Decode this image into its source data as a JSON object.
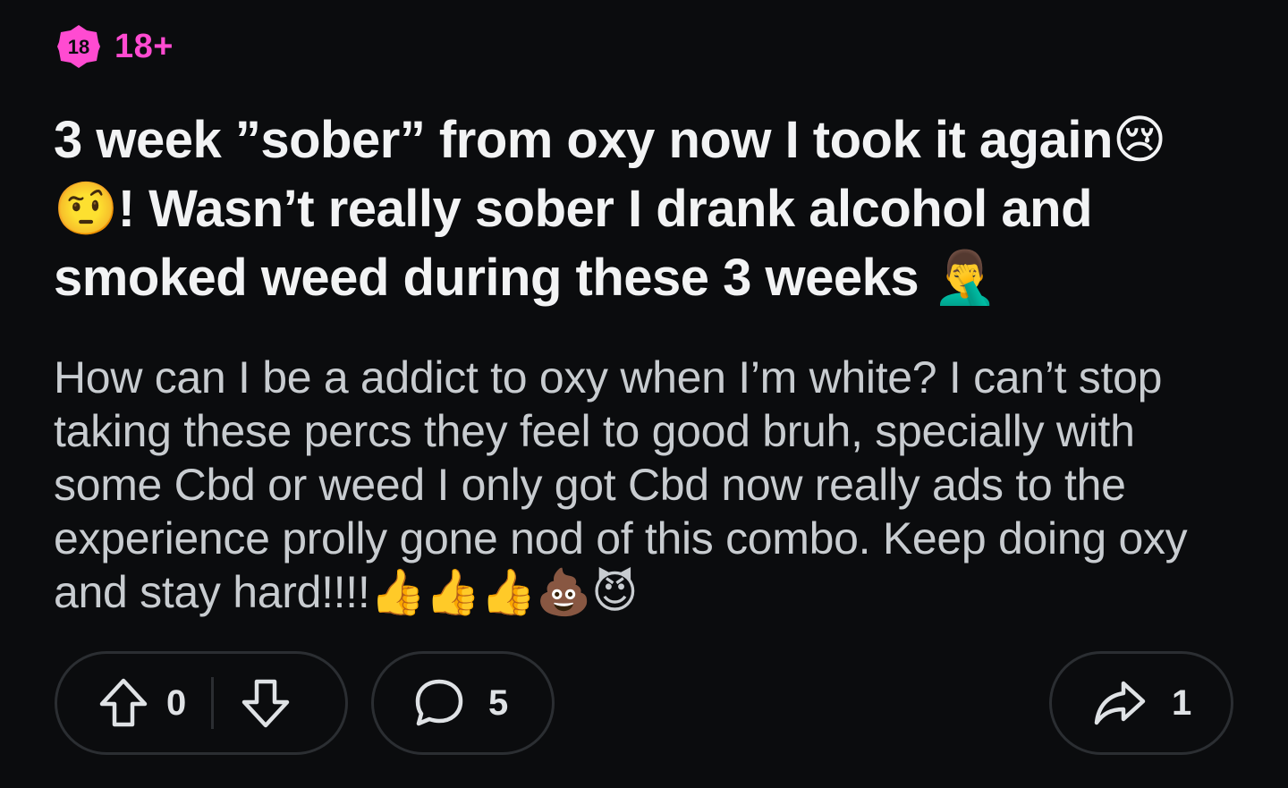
{
  "nsfw": {
    "badge_text": "18",
    "label": "18+",
    "color": "#ff4bd1"
  },
  "post": {
    "title_part1": "3 week ”sober” from oxy now I took it again",
    "title_emoji1": "😢",
    "title_emoji2": "🤨",
    "title_part2": "! Wasn’t really sober I drank alcohol and smoked weed during these 3 weeks ",
    "title_emoji3": "🤦‍♂️",
    "body_text": "How can I be a addict to oxy when I’m white? I can’t stop taking these percs they feel to good bruh, specially with some Cbd or weed I only got Cbd now really ads to the experience prolly gone nod of this combo. Keep doing oxy and stay hard!!!!",
    "body_emojis": "👍👍👍💩😈"
  },
  "actions": {
    "vote_count": "0",
    "comment_count": "5",
    "share_count": "1",
    "icons": [
      "upvote-arrow",
      "downvote-arrow",
      "comment-bubble",
      "share-arrow"
    ]
  }
}
